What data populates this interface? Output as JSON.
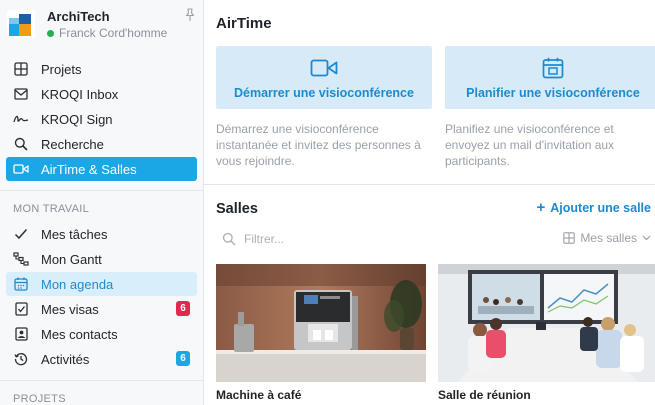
{
  "sidebar": {
    "brand_name": "ArchiTech",
    "user_name": "Franck Cord'homme",
    "nav_top": [
      {
        "label": "Projets",
        "icon": "grid-icon"
      },
      {
        "label": "KROQI Inbox",
        "icon": "mail-icon"
      },
      {
        "label": "KROQI Sign",
        "icon": "signature-icon"
      },
      {
        "label": "Recherche",
        "icon": "search-icon"
      },
      {
        "label": "AirTime & Salles",
        "icon": "video-camera-icon"
      }
    ],
    "section_mon_travail": "MON TRAVAIL",
    "nav_work": [
      {
        "label": "Mes tâches",
        "icon": "check-icon"
      },
      {
        "label": "Mon Gantt",
        "icon": "gantt-icon"
      },
      {
        "label": "Mon agenda",
        "icon": "calendar-icon"
      },
      {
        "label": "Mes visas",
        "icon": "visa-icon",
        "badge": "6"
      },
      {
        "label": "Mes contacts",
        "icon": "contact-icon"
      },
      {
        "label": "Activités",
        "icon": "history-icon",
        "badge": "6"
      }
    ],
    "section_projets": "PROJETS"
  },
  "main": {
    "title": "AirTime",
    "card_start_label": "Démarrer une visioconférence",
    "card_plan_label": "Planifier une visioconférence",
    "desc_start": "Démarrez une visioconférence instantanée et invitez des personnes à vous rejoindre.",
    "desc_plan": "Planifiez une visioconférence et envoyez un mail d'invitation aux participants.",
    "rooms_title": "Salles",
    "add_room_label": "Ajouter une salle",
    "filter_placeholder": "Filtrer...",
    "my_rooms_label": "Mes salles",
    "rooms": [
      {
        "name": "Machine à café"
      },
      {
        "name": "Salle de réunion"
      }
    ]
  },
  "colors": {
    "accent": "#1ba7e6",
    "accent_text": "#1d8ad0",
    "card_bg": "#d6ebf7",
    "badge_red": "#e0294c"
  }
}
